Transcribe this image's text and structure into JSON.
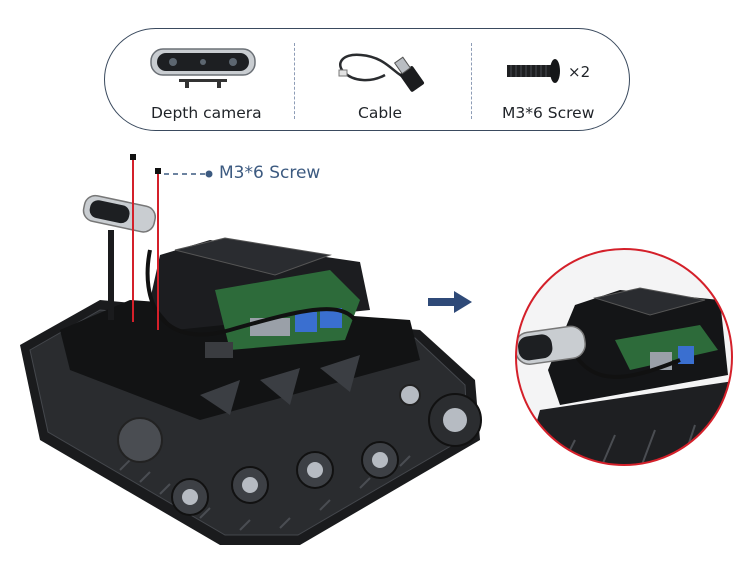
{
  "parts": {
    "depth_camera_label": "Depth camera",
    "cable_label": "Cable",
    "screw_label": "M3*6 Screw",
    "screw_qty": "×2"
  },
  "callout": {
    "screw_label": "M3*6 Screw"
  },
  "colors": {
    "panel_border": "#3a4a5e",
    "divider": "#8d9cb6",
    "callout_text": "#3c5a80",
    "arrow": "#2f4a78",
    "screw_lines": "#d4202a",
    "zoom_circle": "#d4202a"
  }
}
